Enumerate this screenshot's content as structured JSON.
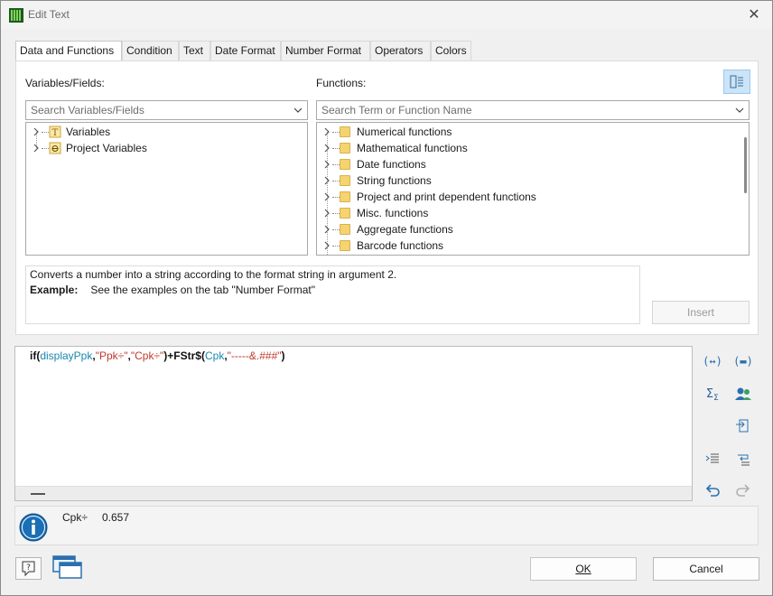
{
  "window": {
    "title": "Edit Text",
    "close_glyph": "✕"
  },
  "tabs": [
    {
      "label": "Data and Functions",
      "active": true
    },
    {
      "label": "Condition",
      "active": false
    },
    {
      "label": "Text",
      "active": false
    },
    {
      "label": "Date Format",
      "active": false
    },
    {
      "label": "Number Format",
      "active": false
    },
    {
      "label": "Operators",
      "active": false
    },
    {
      "label": "Colors",
      "active": false
    }
  ],
  "variables": {
    "label": "Variables/Fields:",
    "search_placeholder": "Search Variables/Fields",
    "items": [
      {
        "label": "Variables",
        "icon": "text-variable-icon"
      },
      {
        "label": "Project Variables",
        "icon": "project-variable-icon"
      }
    ]
  },
  "functions": {
    "label": "Functions:",
    "search_placeholder": "Search Term or Function Name",
    "items": [
      {
        "label": "Numerical functions"
      },
      {
        "label": "Mathematical functions"
      },
      {
        "label": "Date functions"
      },
      {
        "label": "String functions"
      },
      {
        "label": "Project and print dependent functions"
      },
      {
        "label": "Misc. functions"
      },
      {
        "label": "Aggregate functions"
      },
      {
        "label": "Barcode functions"
      }
    ]
  },
  "description": {
    "text": "Converts a number into a string according to the format string in argument 2.",
    "example_label": "Example:",
    "example_text": "See the examples on the tab \"Number Format\""
  },
  "insert_label": "Insert",
  "expression": {
    "tokens": [
      {
        "t": "if(",
        "c": "kw"
      },
      {
        "t": "displayPpk",
        "c": "var"
      },
      {
        "t": ",",
        "c": "kw"
      },
      {
        "t": "\"Ppk÷\"",
        "c": "str"
      },
      {
        "t": ",",
        "c": "kw"
      },
      {
        "t": "\"Cpk÷\"",
        "c": "str"
      },
      {
        "t": ")+FStr$(",
        "c": "kw"
      },
      {
        "t": "Cpk",
        "c": "var"
      },
      {
        "t": ",",
        "c": "kw"
      },
      {
        "t": "\"-----&.###\"",
        "c": "str"
      },
      {
        "t": ")",
        "c": "kw"
      }
    ]
  },
  "result": {
    "label": "Cpk÷",
    "value": "0.657"
  },
  "buttons": {
    "ok": "OK",
    "cancel": "Cancel"
  },
  "colors": {
    "accent": "#1a6fb5",
    "variable_token": "#1a87b0",
    "string_token": "#c0392b",
    "folder": "#f5d371"
  }
}
